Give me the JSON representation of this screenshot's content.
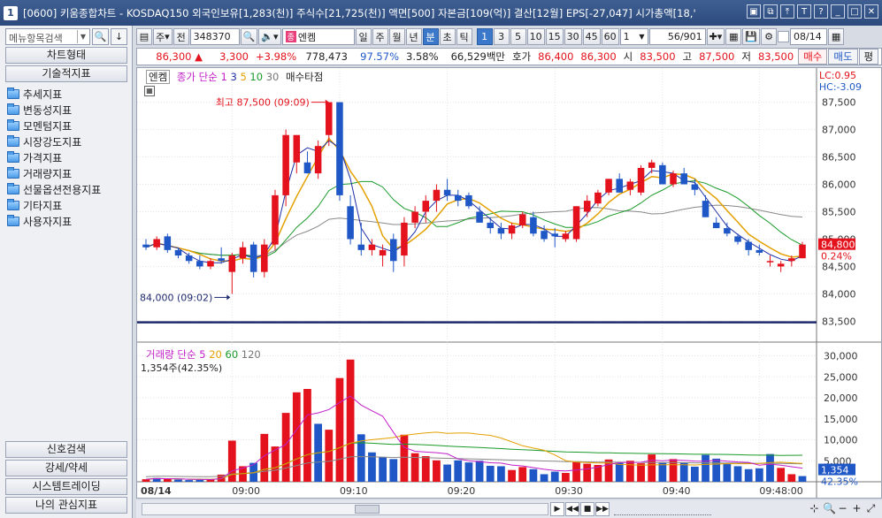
{
  "window": {
    "app_num": "1",
    "title": "[0600] 키움종합차트 - KOSDAQ150 외국인보유[1,283(천)] 주식수[21,725(천)] 액면[500] 자본금[109(억)] 결산[12월] EPS[-27,047] 시가총액[18,'"
  },
  "left_panel": {
    "search_placeholder": "메뉴항목검색",
    "header_chart_type": "차트형태",
    "header_tech": "기술적지표",
    "tree": [
      "추세지표",
      "변동성지표",
      "모멘텀지표",
      "시장강도지표",
      "가격지표",
      "거래량지표",
      "선물옵션전용지표",
      "기타지표",
      "사용자지표"
    ],
    "bottom_buttons": [
      "신호검색",
      "강세/약세",
      "시스템트레이딩",
      "나의 관심지표"
    ]
  },
  "toolbar": {
    "type_select": "주",
    "full_btn": "전",
    "code": "348370",
    "stock_name": "엔켐",
    "stock_tag": "종",
    "periods": [
      "일",
      "주",
      "월",
      "년",
      "분",
      "초",
      "틱"
    ],
    "period_selected": "분",
    "intervals": [
      "1",
      "3",
      "5",
      "10",
      "15",
      "30",
      "45",
      "60"
    ],
    "interval_selected": "1",
    "count_select": "1",
    "page_counter": "56/901",
    "date": "08/14"
  },
  "quote": {
    "price": "86,300",
    "change": "3,300",
    "change_pct": "+3.98%",
    "volume": "778,473",
    "vol_ratio": "97.57%",
    "turnover": "3.58%",
    "amount": "66,529백만",
    "bid_label": "호가",
    "bid1": "86,400",
    "bid2": "86,300",
    "open_label": "시",
    "open": "83,500",
    "high_label": "고",
    "high": "87,500",
    "low_label": "저",
    "low": "83,500",
    "buy_btn": "매수",
    "sell_btn": "매도",
    "eval_btn": "평"
  },
  "chart": {
    "legend_name": "엔켐",
    "legend_ma": "종가 단순",
    "ma_periods": [
      "1",
      "3",
      "5",
      "10",
      "30"
    ],
    "legend_extra": "매수타점",
    "lc": "LC:0.95",
    "hc": "HC:-3.09",
    "volume_legend": "거래량 단순",
    "volume_ma": [
      "5",
      "20",
      "60",
      "120"
    ],
    "volume_info": "1,354주(42.35%)"
  },
  "chart_data": {
    "type": "candlestick",
    "price_axis": [
      "87,500",
      "87,000",
      "86,500",
      "86,000",
      "85,500",
      "85,000",
      "84,500",
      "84,000",
      "83,500"
    ],
    "volume_axis": [
      "30,000",
      "25,000",
      "20,000",
      "15,000",
      "10,000",
      "5,000"
    ],
    "time_labels": [
      {
        "i": 0,
        "t": "08/14"
      },
      {
        "i": 8,
        "t": "09:00"
      },
      {
        "i": 18,
        "t": "09:10"
      },
      {
        "i": 28,
        "t": "09:20"
      },
      {
        "i": 38,
        "t": "09:30"
      },
      {
        "i": 48,
        "t": "09:40"
      },
      {
        "i": 57,
        "t": "09:48:00"
      }
    ],
    "high_label": "최고 87,500 (09:09)",
    "low_label": "최저 84,000 (09:02)",
    "last_price": "84,800",
    "last_pct": "0.24%",
    "last_volume": "1,354",
    "last_volume_pct": "42.35%",
    "candles": [
      {
        "o": 84900,
        "h": 85000,
        "l": 84800,
        "c": 84850
      },
      {
        "o": 84850,
        "h": 85050,
        "l": 84800,
        "c": 85000
      },
      {
        "o": 85050,
        "h": 85100,
        "l": 84750,
        "c": 84800
      },
      {
        "o": 84800,
        "h": 84850,
        "l": 84650,
        "c": 84700
      },
      {
        "o": 84700,
        "h": 84750,
        "l": 84550,
        "c": 84600
      },
      {
        "o": 84600,
        "h": 84700,
        "l": 84450,
        "c": 84500
      },
      {
        "o": 84500,
        "h": 84650,
        "l": 84450,
        "c": 84600
      },
      {
        "o": 84650,
        "h": 84850,
        "l": 84550,
        "c": 84600
      },
      {
        "o": 84400,
        "h": 84750,
        "l": 84000,
        "c": 84700
      },
      {
        "o": 84650,
        "h": 84950,
        "l": 84550,
        "c": 84850
      },
      {
        "o": 84900,
        "h": 84950,
        "l": 84300,
        "c": 84400
      },
      {
        "o": 84400,
        "h": 85000,
        "l": 84300,
        "c": 84900
      },
      {
        "o": 84900,
        "h": 85900,
        "l": 84800,
        "c": 85800
      },
      {
        "o": 85800,
        "h": 87000,
        "l": 85600,
        "c": 86900
      },
      {
        "o": 86400,
        "h": 86900,
        "l": 86200,
        "c": 86900
      },
      {
        "o": 86400,
        "h": 86600,
        "l": 86200,
        "c": 86200
      },
      {
        "o": 86200,
        "h": 86800,
        "l": 86100,
        "c": 86700
      },
      {
        "o": 86900,
        "h": 87500,
        "l": 86700,
        "c": 87500
      },
      {
        "o": 87500,
        "h": 87500,
        "l": 85700,
        "c": 85800
      },
      {
        "o": 85600,
        "h": 85800,
        "l": 84900,
        "c": 85000
      },
      {
        "o": 84900,
        "h": 85300,
        "l": 84700,
        "c": 84800
      },
      {
        "o": 84800,
        "h": 85000,
        "l": 84700,
        "c": 84900
      },
      {
        "o": 84700,
        "h": 84900,
        "l": 84500,
        "c": 84800
      },
      {
        "o": 85000,
        "h": 85100,
        "l": 84400,
        "c": 84600
      },
      {
        "o": 84700,
        "h": 85400,
        "l": 84500,
        "c": 85300
      },
      {
        "o": 85300,
        "h": 85600,
        "l": 85200,
        "c": 85500
      },
      {
        "o": 85500,
        "h": 85800,
        "l": 85300,
        "c": 85700
      },
      {
        "o": 85700,
        "h": 86000,
        "l": 85500,
        "c": 85900
      },
      {
        "o": 85900,
        "h": 86100,
        "l": 85700,
        "c": 85800
      },
      {
        "o": 85800,
        "h": 85900,
        "l": 85600,
        "c": 85700
      },
      {
        "o": 85800,
        "h": 85850,
        "l": 85550,
        "c": 85600
      },
      {
        "o": 85500,
        "h": 85600,
        "l": 85300,
        "c": 85300
      },
      {
        "o": 85300,
        "h": 85400,
        "l": 85100,
        "c": 85200
      },
      {
        "o": 85200,
        "h": 85300,
        "l": 85000,
        "c": 85100
      },
      {
        "o": 85100,
        "h": 85300,
        "l": 85000,
        "c": 85250
      },
      {
        "o": 85250,
        "h": 85500,
        "l": 85200,
        "c": 85450
      },
      {
        "o": 85400,
        "h": 85500,
        "l": 85050,
        "c": 85100
      },
      {
        "o": 85150,
        "h": 85250,
        "l": 84950,
        "c": 85000
      },
      {
        "o": 85100,
        "h": 85200,
        "l": 84850,
        "c": 85050
      },
      {
        "o": 85000,
        "h": 85150,
        "l": 84950,
        "c": 85100
      },
      {
        "o": 85000,
        "h": 85600,
        "l": 84950,
        "c": 85600
      },
      {
        "o": 85500,
        "h": 85800,
        "l": 85400,
        "c": 85700
      },
      {
        "o": 85650,
        "h": 85900,
        "l": 85600,
        "c": 85850
      },
      {
        "o": 85850,
        "h": 86100,
        "l": 85800,
        "c": 86100
      },
      {
        "o": 86100,
        "h": 86200,
        "l": 85850,
        "c": 85850
      },
      {
        "o": 85900,
        "h": 86100,
        "l": 85800,
        "c": 86050
      },
      {
        "o": 85850,
        "h": 86350,
        "l": 85800,
        "c": 86300
      },
      {
        "o": 86300,
        "h": 86450,
        "l": 86200,
        "c": 86400
      },
      {
        "o": 86350,
        "h": 86400,
        "l": 86000,
        "c": 86000
      },
      {
        "o": 86000,
        "h": 86250,
        "l": 85950,
        "c": 86200
      },
      {
        "o": 86200,
        "h": 86300,
        "l": 86000,
        "c": 86000
      },
      {
        "o": 86000,
        "h": 86100,
        "l": 85800,
        "c": 85900
      },
      {
        "o": 85700,
        "h": 85800,
        "l": 85400,
        "c": 85400
      },
      {
        "o": 85300,
        "h": 85400,
        "l": 85200,
        "c": 85200
      },
      {
        "o": 85200,
        "h": 85300,
        "l": 85050,
        "c": 85100
      },
      {
        "o": 85050,
        "h": 85100,
        "l": 84900,
        "c": 84950
      },
      {
        "o": 84950,
        "h": 85000,
        "l": 84700,
        "c": 84800
      },
      {
        "o": 84800,
        "h": 84900,
        "l": 84700,
        "c": 84750
      },
      {
        "o": 84600,
        "h": 84700,
        "l": 84500,
        "c": 84600
      },
      {
        "o": 84500,
        "h": 84600,
        "l": 84400,
        "c": 84550
      },
      {
        "o": 84600,
        "h": 84700,
        "l": 84500,
        "c": 84650
      },
      {
        "o": 84650,
        "h": 84950,
        "l": 84650,
        "c": 84900
      }
    ],
    "volumes": [
      600,
      900,
      700,
      500,
      400,
      450,
      600,
      1700,
      9800,
      3700,
      4500,
      11400,
      8400,
      16400,
      21300,
      22100,
      13800,
      12400,
      24700,
      29100,
      11300,
      7000,
      5900,
      5400,
      11200,
      6800,
      6100,
      5100,
      4100,
      5100,
      4600,
      5000,
      3800,
      3700,
      2800,
      3500,
      3000,
      1800,
      2400,
      2100,
      4700,
      4300,
      4000,
      5300,
      4500,
      5000,
      4400,
      6500,
      4500,
      5400,
      4600,
      3600,
      6400,
      5500,
      4400,
      3700,
      3000,
      3200,
      6600,
      3300,
      1800,
      1354
    ],
    "volume_colors": [
      "r",
      "b",
      "r",
      "b",
      "b",
      "b",
      "r",
      "r",
      "r",
      "r",
      "b",
      "r",
      "r",
      "r",
      "r",
      "r",
      "b",
      "r",
      "r",
      "r",
      "b",
      "b",
      "b",
      "b",
      "r",
      "r",
      "r",
      "r",
      "b",
      "b",
      "b",
      "b",
      "b",
      "b",
      "r",
      "r",
      "b",
      "b",
      "b",
      "r",
      "r",
      "r",
      "r",
      "r",
      "b",
      "r",
      "r",
      "r",
      "b",
      "r",
      "b",
      "b",
      "b",
      "b",
      "b",
      "b",
      "b",
      "b",
      "b",
      "r",
      "r",
      "b"
    ]
  }
}
